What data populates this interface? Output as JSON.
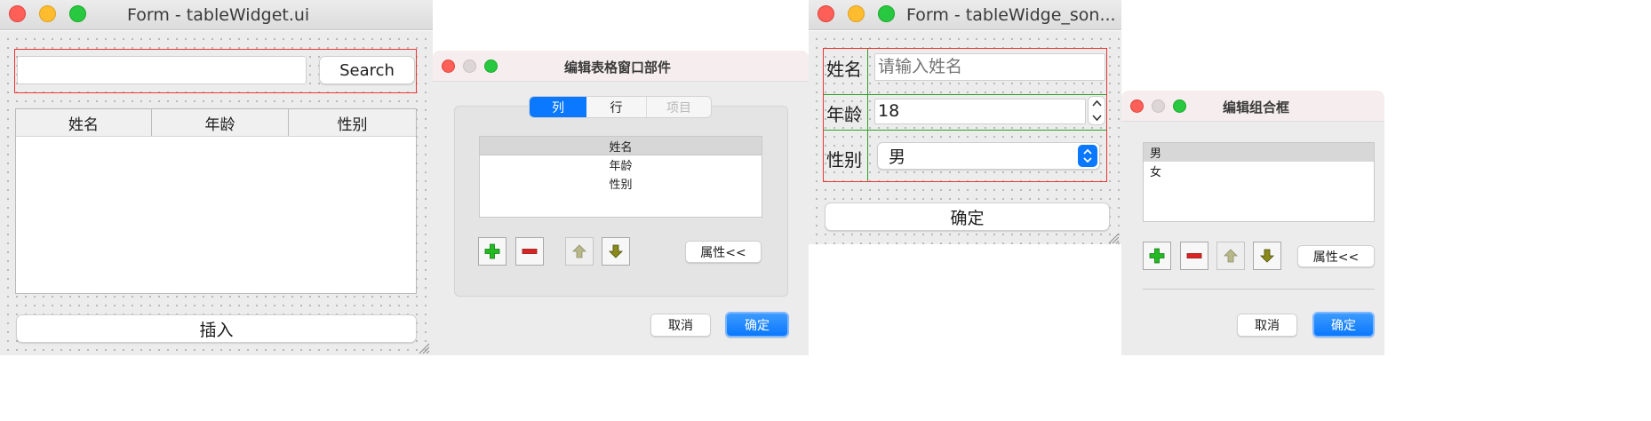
{
  "win1": {
    "title": "Form - tableWidget.ui",
    "search_button": "Search",
    "search_value": "",
    "table_headers": [
      "姓名",
      "年龄",
      "性别"
    ],
    "insert_button": "插入"
  },
  "win2": {
    "title": "编辑表格窗口部件",
    "tabs": [
      {
        "label": "列",
        "state": "active"
      },
      {
        "label": "行",
        "state": "normal"
      },
      {
        "label": "项目",
        "state": "disabled"
      }
    ],
    "columns": [
      "姓名",
      "年龄",
      "性别"
    ],
    "properties_button": "属性<<",
    "cancel_button": "取消",
    "ok_button": "确定"
  },
  "win3": {
    "title": "Form - tableWidge_son...",
    "name_label": "姓名",
    "name_placeholder": "请输入姓名",
    "age_label": "年龄",
    "age_value": "18",
    "gender_label": "性别",
    "gender_value": "男",
    "confirm_button": "确定"
  },
  "win4": {
    "title": "编辑组合框",
    "items": [
      "男",
      "女"
    ],
    "properties_button": "属性<<",
    "cancel_button": "取消",
    "ok_button": "确定"
  },
  "colors": {
    "accent_blue": "#0a78ff",
    "form_outline_red": "#ee3535",
    "grid_line_green": "#2ea02e",
    "add_icon_green": "#22bb22",
    "remove_icon_red": "#dd2222",
    "arrow_olive": "#8a8a1a"
  }
}
